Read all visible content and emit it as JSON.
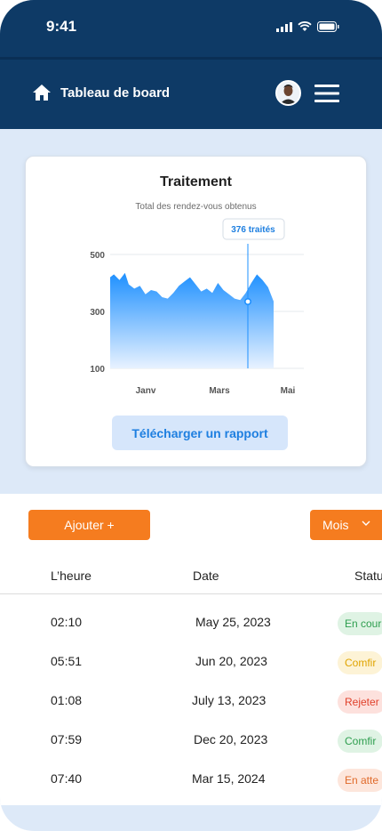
{
  "status_bar": {
    "time": "9:41"
  },
  "header": {
    "title": "Tableau de board",
    "icons": [
      "home-icon",
      "avatar",
      "menu-icon"
    ]
  },
  "card": {
    "title": "Traitement",
    "subtitle": "Total des rendez-vous obtenus",
    "tooltip": "376 traités",
    "download_label": "Télécharger un rapport"
  },
  "chart_data": {
    "type": "area",
    "y_ticks": [
      "500",
      "300",
      "100"
    ],
    "x_ticks": [
      "Janv",
      "Mars",
      "Mai"
    ],
    "ylim": [
      100,
      500
    ],
    "x": [
      0,
      0.02,
      0.05,
      0.08,
      0.1,
      0.13,
      0.16,
      0.19,
      0.22,
      0.25,
      0.28,
      0.31,
      0.34,
      0.37,
      0.4,
      0.43,
      0.46,
      0.49,
      0.52,
      0.55,
      0.58,
      0.61,
      0.64,
      0.67,
      0.7,
      0.73,
      0.76,
      0.79,
      0.82,
      0.85,
      0.88
    ],
    "values": [
      420,
      430,
      410,
      435,
      395,
      380,
      390,
      360,
      375,
      370,
      350,
      345,
      365,
      390,
      405,
      420,
      395,
      370,
      380,
      365,
      400,
      375,
      360,
      345,
      340,
      365,
      400,
      430,
      410,
      385,
      335
    ],
    "grid": true,
    "color": "#1e90ff"
  },
  "controls": {
    "add_label": "Ajouter +",
    "month_label": "Mois"
  },
  "table": {
    "headers": [
      "L’heure",
      "Date",
      "Statu"
    ],
    "rows": [
      {
        "time": "02:10",
        "date": "May 25, 2023",
        "status": "En cour",
        "color": "#2e9e4f",
        "bg": "#dff3e4"
      },
      {
        "time": "05:51",
        "date": "Jun 20, 2023",
        "status": "Comfir",
        "color": "#e0a400",
        "bg": "#fdf3d6"
      },
      {
        "time": "01:08",
        "date": "July 13, 2023",
        "status": "Rejeter",
        "color": "#e0402a",
        "bg": "#fde1dd"
      },
      {
        "time": "07:59",
        "date": "Dec 20, 2023",
        "status": "Comfir",
        "color": "#2e9e4f",
        "bg": "#dff3e4"
      },
      {
        "time": "07:40",
        "date": "Mar 15, 2024",
        "status": "En atte",
        "color": "#e06a2a",
        "bg": "#fde6dc"
      }
    ]
  }
}
